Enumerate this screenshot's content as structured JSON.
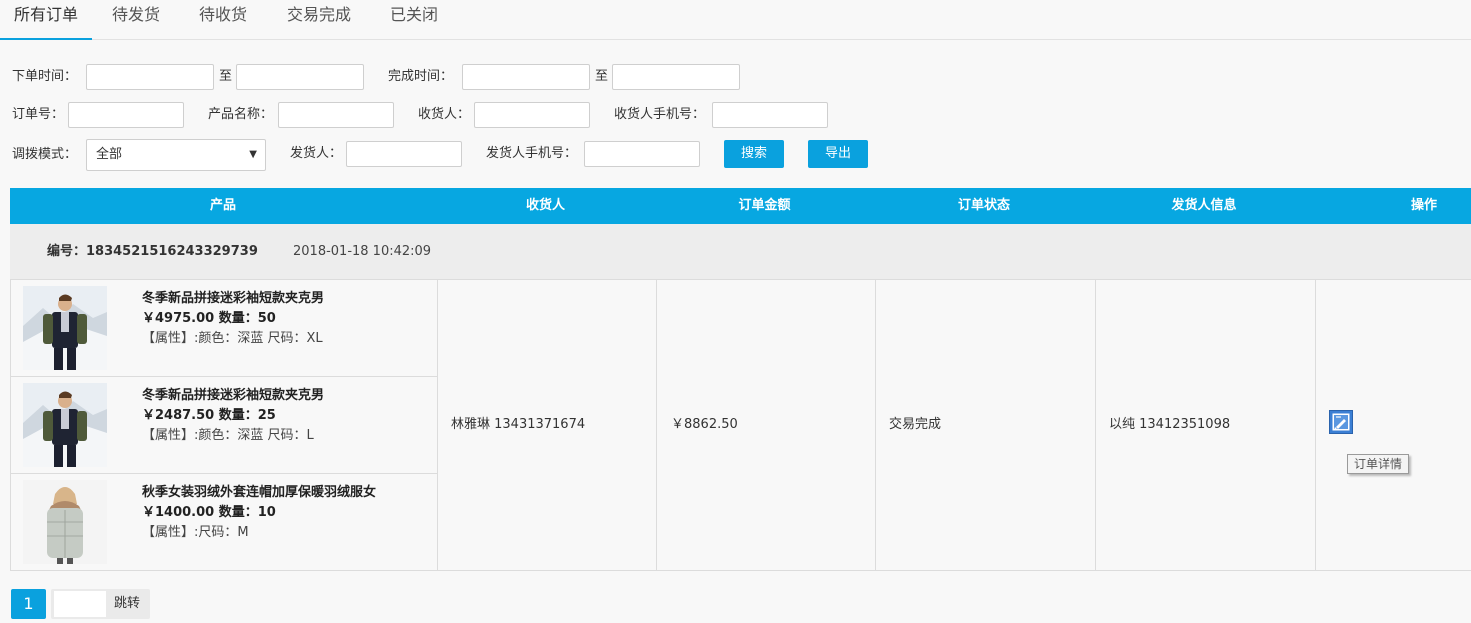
{
  "tabs": [
    {
      "label": "所有订单",
      "active": true
    },
    {
      "label": "待发货",
      "active": false
    },
    {
      "label": "待收货",
      "active": false
    },
    {
      "label": "交易完成",
      "active": false
    },
    {
      "label": "已关闭",
      "active": false
    }
  ],
  "filters": {
    "order_time_label": "下单时间：",
    "to_label_1": "至",
    "complete_time_label": "完成时间：",
    "to_label_2": "至",
    "order_no_label": "订单号：",
    "product_name_label": "产品名称：",
    "receiver_label": "收货人：",
    "receiver_phone_label": "收货人手机号：",
    "mode_label": "调拨模式：",
    "mode_value": "全部",
    "sender_label": "发货人：",
    "sender_phone_label": "发货人手机号：",
    "search_button": "搜索",
    "export_button": "导出"
  },
  "table": {
    "headers": [
      "产品",
      "收货人",
      "订单金额",
      "订单状态",
      "发货人信息",
      "操作"
    ]
  },
  "order": {
    "number": "编号：1834521516243329739",
    "time": "2018-01-18 10:42:09",
    "products": [
      {
        "name": "冬季新品拼接迷彩袖短款夹克男",
        "price_qty": "￥4975.00 数量：50",
        "attr": "【属性】:颜色：深蓝 尺码：XL"
      },
      {
        "name": "冬季新品拼接迷彩袖短款夹克男",
        "price_qty": "￥2487.50 数量：25",
        "attr": "【属性】:颜色：深蓝 尺码：L"
      },
      {
        "name": "秋季女装羽绒外套连帽加厚保暖羽绒服女",
        "price_qty": "￥1400.00 数量：10",
        "attr": "【属性】:尺码：M"
      }
    ],
    "receiver": "林雅琳 13431371674",
    "amount": "￥8862.50",
    "status": "交易完成",
    "sender": "以纯 13412351098",
    "action_tooltip": "订单详情"
  },
  "pagination": {
    "current_page": "1",
    "jump_label": "跳转"
  },
  "colors": {
    "accent": "#0aa1de",
    "table_header": "#07a7e1"
  }
}
